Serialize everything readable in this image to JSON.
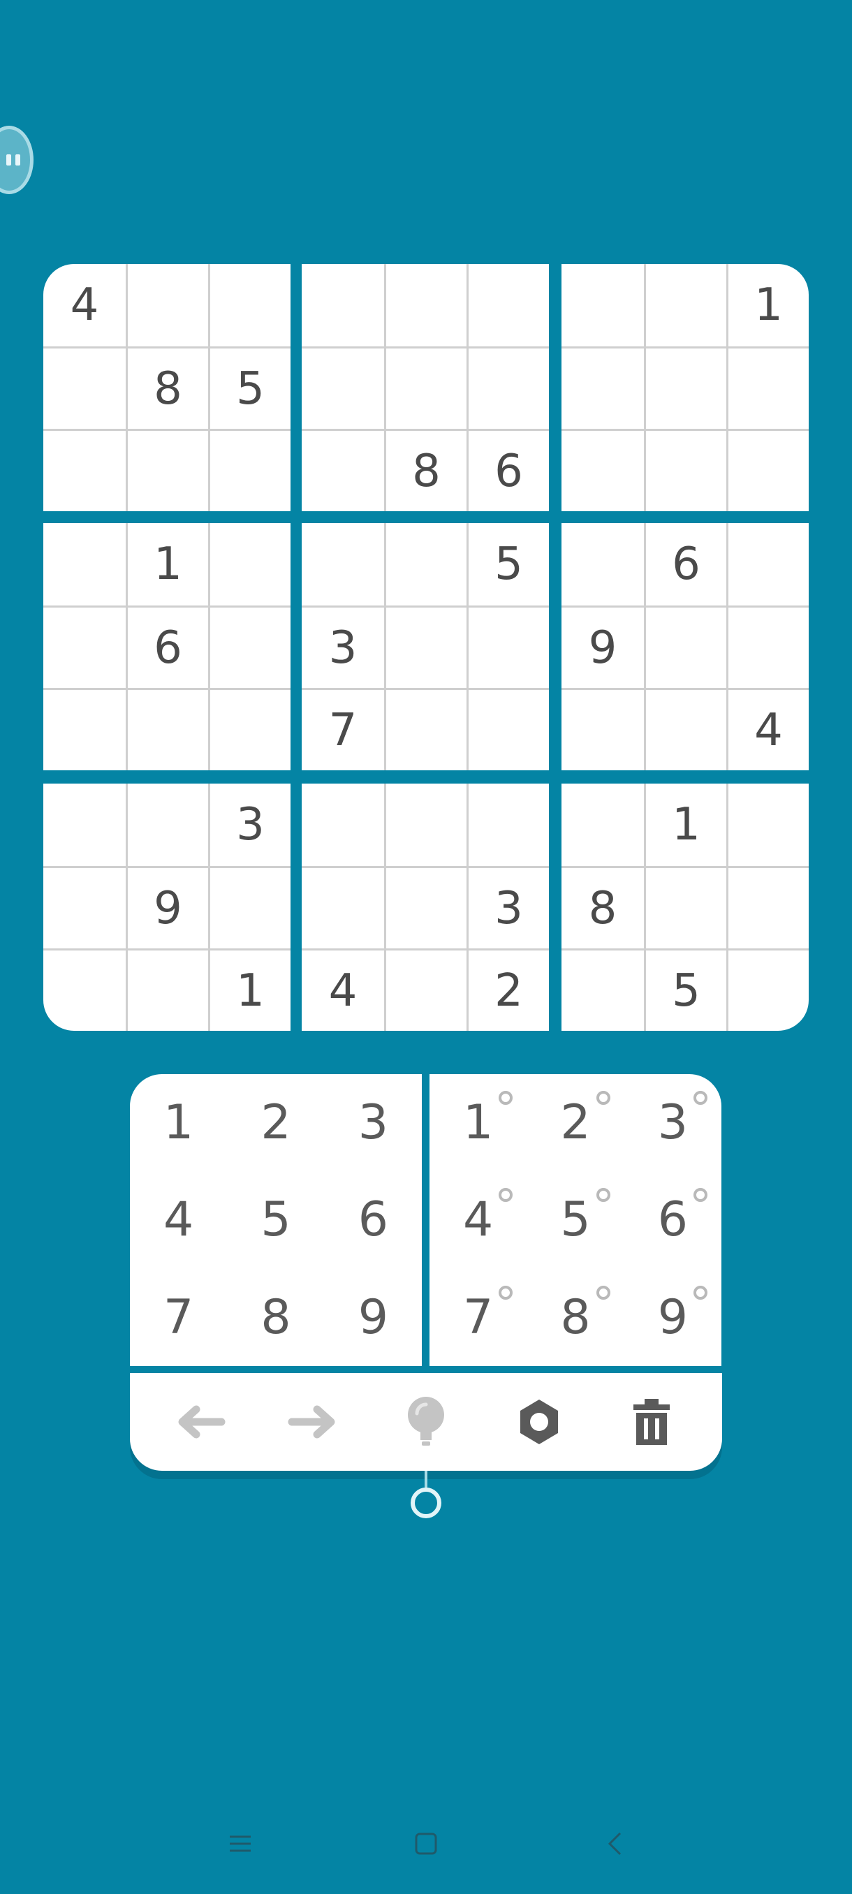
{
  "board": {
    "boxes": [
      {
        "cells": [
          "4",
          "",
          "",
          "",
          "8",
          "5",
          "",
          "",
          ""
        ]
      },
      {
        "cells": [
          "",
          "",
          "",
          "",
          "",
          "",
          "",
          "8",
          "6"
        ]
      },
      {
        "cells": [
          "",
          "",
          "1",
          "",
          "",
          "",
          "",
          "",
          ""
        ]
      },
      {
        "cells": [
          "",
          "1",
          "",
          "",
          "6",
          "",
          "",
          "",
          ""
        ]
      },
      {
        "cells": [
          "",
          "",
          "5",
          "3",
          "",
          "",
          "7",
          "",
          ""
        ]
      },
      {
        "cells": [
          "",
          "6",
          "",
          "9",
          "",
          "",
          "",
          "",
          "4"
        ]
      },
      {
        "cells": [
          "",
          "",
          "3",
          "",
          "9",
          "",
          "",
          "",
          "1"
        ]
      },
      {
        "cells": [
          "",
          "",
          "",
          "",
          "",
          "3",
          "4",
          "",
          "2"
        ]
      },
      {
        "cells": [
          "",
          "1",
          "",
          "8",
          "",
          "",
          "",
          "5",
          ""
        ]
      }
    ]
  },
  "number_pad": {
    "keys": [
      "1",
      "2",
      "3",
      "4",
      "5",
      "6",
      "7",
      "8",
      "9"
    ]
  },
  "notes_pad": {
    "keys": [
      "1",
      "2",
      "3",
      "4",
      "5",
      "6",
      "7",
      "8",
      "9"
    ]
  },
  "toolbar": {
    "icons": [
      "undo-arrow-icon",
      "redo-arrow-icon",
      "hint-lightbulb-icon",
      "settings-gear-icon",
      "delete-trash-icon"
    ]
  },
  "colors": {
    "background": "#0484a4",
    "board": "#ffffff",
    "digit": "#4a4a4a",
    "disabled_icon": "#c4c4c4",
    "active_icon": "#5a5a5a"
  }
}
